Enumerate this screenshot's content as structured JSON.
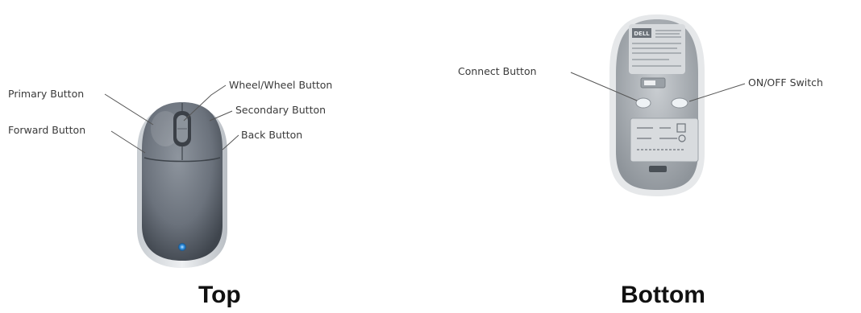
{
  "top_view": {
    "caption": "Top",
    "labels": {
      "primary": "Primary Button",
      "forward": "Forward Button",
      "wheel": "Wheel/Wheel Button",
      "secondary": "Secondary Button",
      "back": "Back Button"
    }
  },
  "bottom_view": {
    "caption": "Bottom",
    "labels": {
      "connect": "Connect Button",
      "power": "ON/OFF Switch"
    },
    "logo_text": "DELL"
  },
  "colors": {
    "mouse_top_body": "#6f7680",
    "mouse_bottom_shell": "#b8bdc2",
    "led": "#2f8fe0",
    "leader_line": "#555555"
  }
}
